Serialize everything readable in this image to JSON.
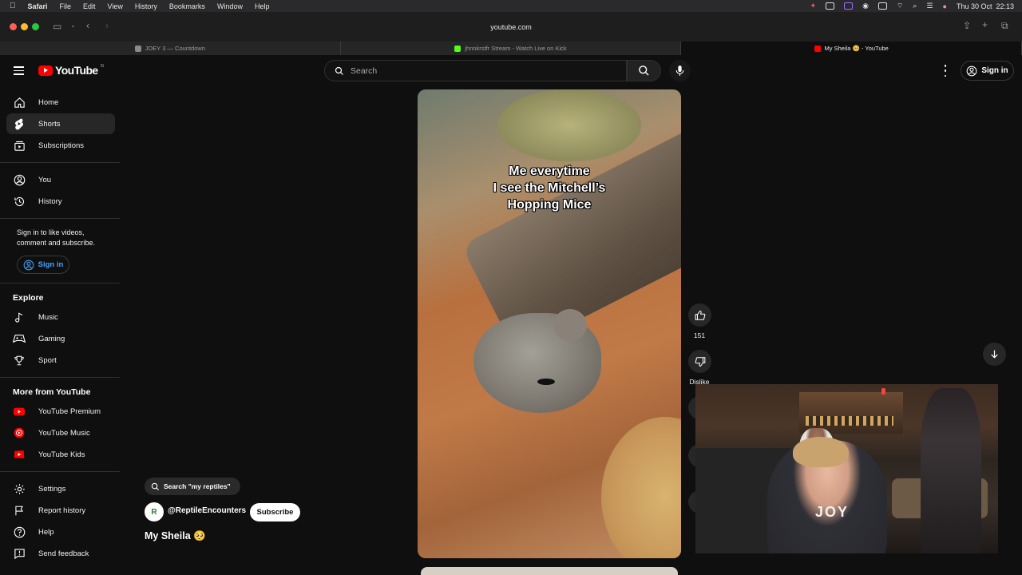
{
  "menubar": {
    "items": [
      "Safari",
      "File",
      "Edit",
      "View",
      "History",
      "Bookmarks",
      "Window",
      "Help"
    ],
    "clock": "Thu 30 Oct  22:13"
  },
  "toolbar": {
    "address": "youtube.com"
  },
  "tabs": [
    {
      "label": "JOEY 3 — Countdown",
      "favicon_color": "#8a8a8a"
    },
    {
      "label": "jhnnkrstfr Stream - Watch Live on Kick",
      "favicon_color": "#53fc18"
    },
    {
      "label": "My Sheila 🥺 - YouTube",
      "favicon_color": "#ff0000"
    }
  ],
  "header": {
    "logo_text": "YouTube",
    "logo_region": "IS",
    "search_placeholder": "Search",
    "signin_label": "Sign in"
  },
  "sidebar": {
    "main": [
      {
        "label": "Home",
        "icon": "home-icon"
      },
      {
        "label": "Shorts",
        "icon": "shorts-icon",
        "active": true
      },
      {
        "label": "Subscriptions",
        "icon": "subscriptions-icon"
      }
    ],
    "you": [
      {
        "label": "You",
        "icon": "account-icon"
      },
      {
        "label": "History",
        "icon": "history-icon"
      }
    ],
    "signin_message": "Sign in to like videos, comment and subscribe.",
    "signin_label": "Sign in",
    "explore_heading": "Explore",
    "explore": [
      {
        "label": "Music",
        "icon": "music-icon"
      },
      {
        "label": "Gaming",
        "icon": "gaming-icon"
      },
      {
        "label": "Sport",
        "icon": "trophy-icon"
      }
    ],
    "more_heading": "More from YouTube",
    "more": [
      {
        "label": "YouTube Premium",
        "icon": "yt-premium-icon"
      },
      {
        "label": "YouTube Music",
        "icon": "yt-music-icon"
      },
      {
        "label": "YouTube Kids",
        "icon": "yt-kids-icon"
      }
    ],
    "footer": [
      {
        "label": "Settings",
        "icon": "gear-icon"
      },
      {
        "label": "Report history",
        "icon": "flag-icon"
      },
      {
        "label": "Help",
        "icon": "help-icon"
      },
      {
        "label": "Send feedback",
        "icon": "feedback-icon"
      }
    ]
  },
  "short": {
    "caption": "Me everytime\nI see the Mitchell’s\nHopping Mice",
    "like_count": "151",
    "dislike_label": "Dislike",
    "search_chip": "Search \"my reptiles\"",
    "channel_initial": "R",
    "channel_handle": "@ReptileEncounters",
    "subscribe_label": "Subscribe",
    "title": "My Sheila 🥺"
  },
  "webcam": {
    "shirt_text": "JOY"
  },
  "colors": {
    "brand_red": "#ff0000",
    "link_blue": "#3ea6ff",
    "background": "#0f0f0f"
  }
}
